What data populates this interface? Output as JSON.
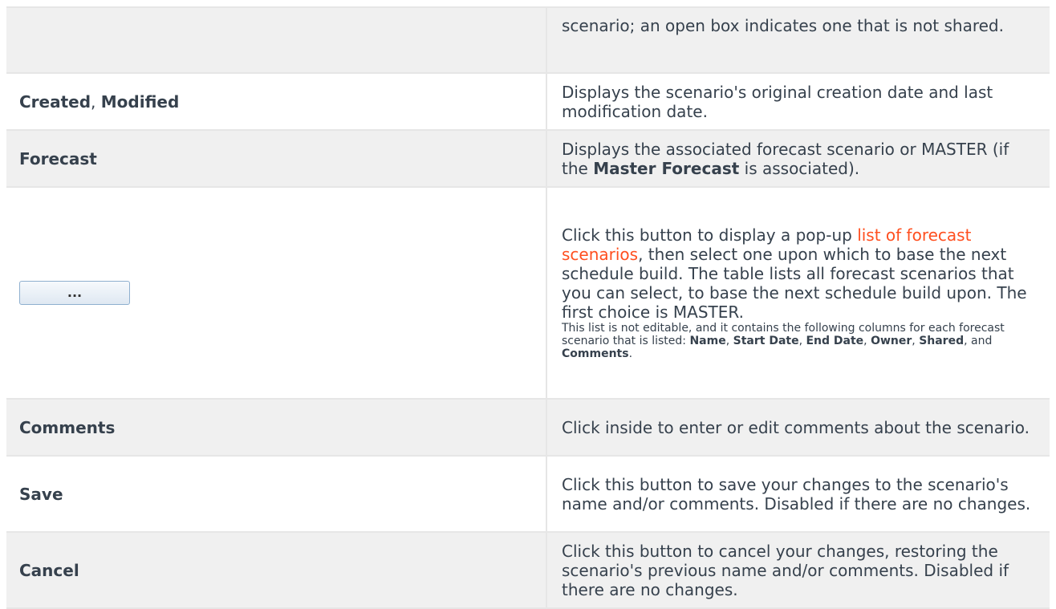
{
  "rows": {
    "continuation": {
      "description": "scenario; an open box indicates one that is not shared."
    },
    "created_modified": {
      "label_created": "Created",
      "label_sep": ", ",
      "label_modified": "Modified",
      "description": "Displays the scenario's original creation date and last modification date."
    },
    "forecast": {
      "label": "Forecast",
      "description_pre": "Displays the associated forecast scenario or MASTER (if the ",
      "description_bold": "Master Forecast",
      "description_post": " is associated)."
    },
    "browse_button": {
      "button_label": "...",
      "description_pre": "Click this button to display a pop-up ",
      "description_link": "list of forecast scenarios",
      "description_post": ", then select one upon which to base the next schedule build. The table lists all forecast scenarios that you can select, to base the next schedule build upon. The first choice is MASTER.",
      "note_pre": "This list is not editable, and it contains the following columns for each forecast scenario that is listed: ",
      "columns": [
        "Name",
        "Start Date",
        "End Date",
        "Owner",
        "Shared",
        "Comments"
      ],
      "sep": ", ",
      "sep_last": ", and ",
      "note_end": "."
    },
    "comments": {
      "label": "Comments",
      "description": "Click inside to enter or edit comments about the scenario."
    },
    "save": {
      "label": "Save",
      "description": "Click this button to save your changes to the scenario's name and/or comments. Disabled if there are no changes."
    },
    "cancel": {
      "label": "Cancel",
      "description": "Click this button to cancel your changes, restoring the scenario's previous name and/or comments. Disabled if there are no changes."
    }
  },
  "colors": {
    "text": "#36414d",
    "link": "#ff4f1f",
    "row_alt": "#f0f0f0",
    "border": "#e6e6e6"
  }
}
